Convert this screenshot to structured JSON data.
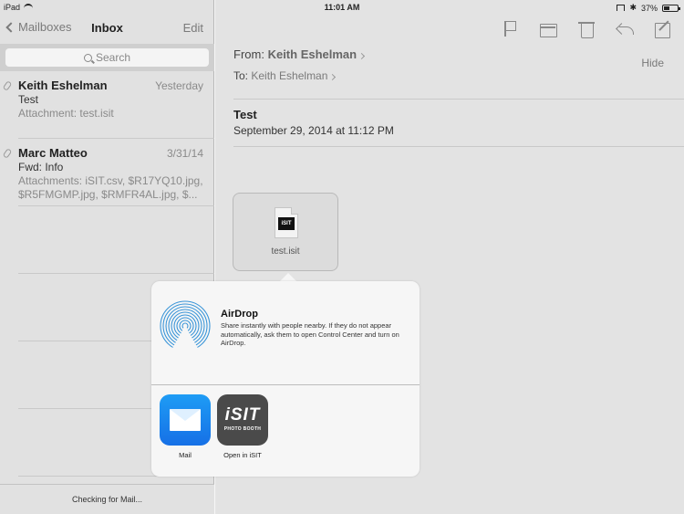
{
  "status_bar": {
    "device": "iPad",
    "time": "11:01 AM",
    "battery": "37%"
  },
  "left_nav": {
    "back_label": "Mailboxes",
    "title": "Inbox",
    "edit_label": "Edit"
  },
  "search": {
    "placeholder": "Search"
  },
  "messages": [
    {
      "sender": "Keith Eshelman",
      "date": "Yesterday",
      "subject": "Test",
      "preview": "Attachment: test.isit"
    },
    {
      "sender": "Marc Matteo",
      "date": "3/31/14",
      "subject": "Fwd: Info",
      "preview": "Attachments: iSIT.csv, $R17YQ10.jpg, $R5FMGMP.jpg, $RMFR4AL.jpg, $..."
    }
  ],
  "footer": {
    "status": "Checking for Mail..."
  },
  "toolbar": {
    "icons": [
      "flag-icon",
      "folder-icon",
      "trash-icon",
      "reply-icon",
      "compose-icon"
    ]
  },
  "email": {
    "from_label": "From:",
    "from_name": "Keith Eshelman",
    "hide_label": "Hide",
    "to_label": "To:",
    "to_name": "Keith Eshelman",
    "subject": "Test",
    "date": "September 29, 2014 at 11:12 PM",
    "attachment_name": "test.isit",
    "attachment_badge": "iSIT"
  },
  "share_sheet": {
    "airdrop_title": "AirDrop",
    "airdrop_desc": "Share instantly with people nearby. If they do not appear automatically, ask them to open Control Center and turn on AirDrop.",
    "apps": [
      {
        "label": "Mail"
      },
      {
        "label": "Open in iSIT",
        "logo_text": "iSIT",
        "logo_sub": "PHOTO BOOTH"
      }
    ]
  }
}
